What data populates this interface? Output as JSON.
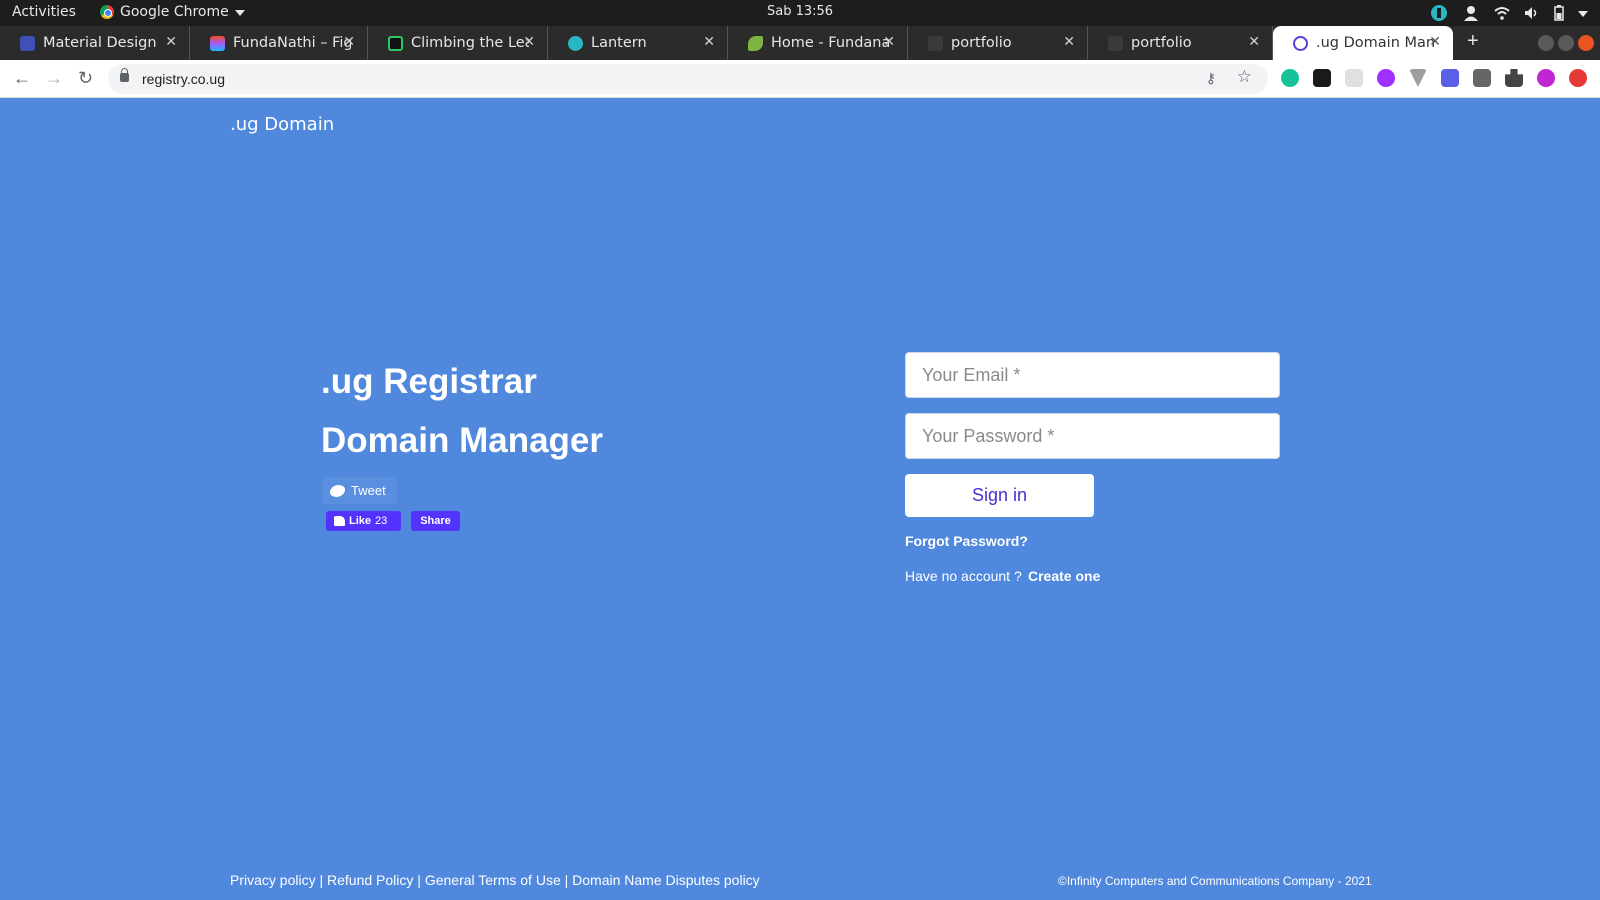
{
  "system": {
    "activities": "Activities",
    "app_name": "Google Chrome",
    "clock": "Sab 13:56"
  },
  "tabs": [
    {
      "title": "Material Design I",
      "favicon_color": "#3f51b5"
    },
    {
      "title": "FundaNathi – Fig",
      "favicon_color": "#f24e1e"
    },
    {
      "title": "Climbing the Lea",
      "favicon_color": "#111111"
    },
    {
      "title": "Lantern",
      "favicon_color": "#29b6c5"
    },
    {
      "title": "Home - Fundanat",
      "favicon_color": "#7cb342"
    },
    {
      "title": "portfolio",
      "favicon_color": "#444444"
    },
    {
      "title": "portfolio",
      "favicon_color": "#444444"
    },
    {
      "title": ".ug Domain Man",
      "favicon_color": "#5b3fd6",
      "active": true
    }
  ],
  "browser": {
    "url": "registry.co.ug"
  },
  "page": {
    "brand": ".ug Domain",
    "headline_1": ".ug Registrar",
    "headline_2": "Domain Manager",
    "social": {
      "tweet": "Tweet",
      "like": "Like",
      "like_count": "23",
      "share": "Share"
    },
    "login": {
      "email_placeholder": "Your Email *",
      "password_placeholder": "Your Password *",
      "signin": "Sign in",
      "forgot": "Forgot Password?",
      "no_account": "Have no account ?",
      "create": "Create one"
    },
    "footer": {
      "privacy": "Privacy policy",
      "refund": "Refund Policy",
      "terms": "General Terms of Use",
      "disputes": "Domain Name Disputes policy",
      "separator": " | ",
      "copyright": "©Infinity Computers and Communications Company - 2021"
    }
  },
  "colors": {
    "page_background": "#4f88dd",
    "button_text": "#4a2ccf",
    "facebook_button": "#5433ff"
  }
}
